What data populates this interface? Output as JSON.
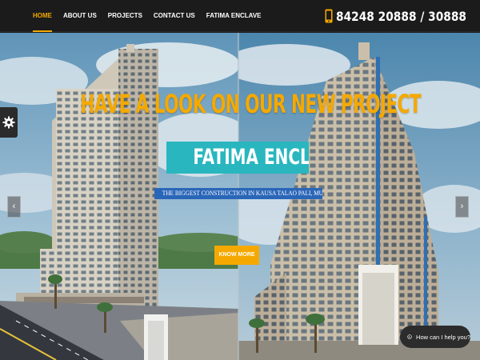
{
  "header": {
    "nav": [
      {
        "label": "HOME",
        "active": true
      },
      {
        "label": "ABOUT US",
        "active": false
      },
      {
        "label": "PROJECTS",
        "active": false
      },
      {
        "label": "CONTACT US",
        "active": false
      },
      {
        "label": "FATIMA ENCLAVE",
        "active": false
      }
    ],
    "phone": "84248 20888 / 30888",
    "phone_icon": "mobile-phone-icon"
  },
  "hero": {
    "headline": "HAVE A LOOK ON OUR NEW PROJECT",
    "project_name": "FATIMA ENCLAVE",
    "tagline": "THE BIGGEST CONSTRUCTION IN KAUSA TALAO PALI, MUMBRA",
    "cta_label": "KNOW MORE",
    "prev_icon": "chevron-left-icon",
    "next_icon": "chevron-right-icon"
  },
  "widgets": {
    "settings_icon": "gear-icon",
    "chat_label": "How can I help you?",
    "chat_icon": "whatsapp-icon"
  },
  "colors": {
    "accent": "#f5a900",
    "header_bg": "#1b1b1b",
    "title_box": "#29b6bf",
    "tagline_box": "#2a66b8"
  }
}
